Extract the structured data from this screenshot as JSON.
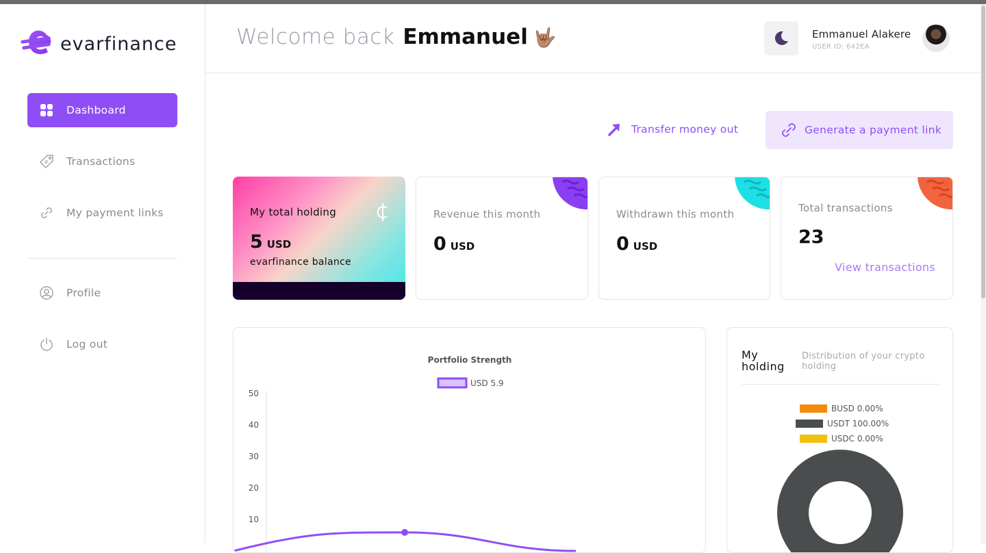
{
  "brand": {
    "name": "evarfinance",
    "accent": "#8f4ef5"
  },
  "sidebar": {
    "items": [
      {
        "label": "Dashboard",
        "icon": "grid-icon",
        "active": true
      },
      {
        "label": "Transactions",
        "icon": "tag-icon",
        "active": false
      },
      {
        "label": "My payment links",
        "icon": "link-icon",
        "active": false
      },
      {
        "label": "Profile",
        "icon": "user-circle-icon",
        "active": false
      },
      {
        "label": "Log out",
        "icon": "power-icon",
        "active": false
      }
    ]
  },
  "header": {
    "greeting": "Welcome back",
    "first_name": "Emmanuel",
    "emoji": "🤟🏽",
    "theme_icon": "moon-icon",
    "user_name": "Emmanuel Alakere",
    "user_id": "USER ID: 642EA"
  },
  "actions": {
    "transfer_label": "Transfer money out",
    "paylink_label": "Generate a payment link"
  },
  "cards": {
    "holding": {
      "title": "My total holding",
      "value": "5",
      "unit": "USD",
      "sub": "evarfinance balance"
    },
    "revenue": {
      "title": "Revenue this month",
      "value": "0",
      "unit": "USD",
      "corner_color": "#8a3ff0"
    },
    "withdrawn": {
      "title": "Withdrawn this month",
      "value": "0",
      "unit": "USD",
      "corner_color": "#1de0e6"
    },
    "transactions": {
      "title": "Total transactions",
      "value": "23",
      "link": "View transactions",
      "corner_color": "#f2643f"
    }
  },
  "chart_data": {
    "type": "line",
    "title": "Portfolio Strength",
    "series": [
      {
        "name": "USD 5.9",
        "color": "#8f4ef5",
        "points": [
          {
            "x": 0,
            "y": 0
          },
          {
            "x": 1,
            "y": 5.9
          },
          {
            "x": 2,
            "y": 0
          }
        ]
      }
    ],
    "yticks": [
      "50",
      "40",
      "30",
      "20",
      "10"
    ],
    "ylim": [
      0,
      50
    ]
  },
  "holding_panel": {
    "title": "My holding",
    "subtitle": "Distribution of your crypto holding",
    "legend": [
      {
        "label": "BUSD 0.00%",
        "color": "#f28a0a"
      },
      {
        "label": "USDT 100.00%",
        "color": "#4a4d4d"
      },
      {
        "label": "USDC 0.00%",
        "color": "#f0c010"
      }
    ],
    "chart_data": {
      "type": "pie",
      "labels": [
        "BUSD",
        "USDT",
        "USDC"
      ],
      "values": [
        0,
        100,
        0
      ]
    }
  }
}
